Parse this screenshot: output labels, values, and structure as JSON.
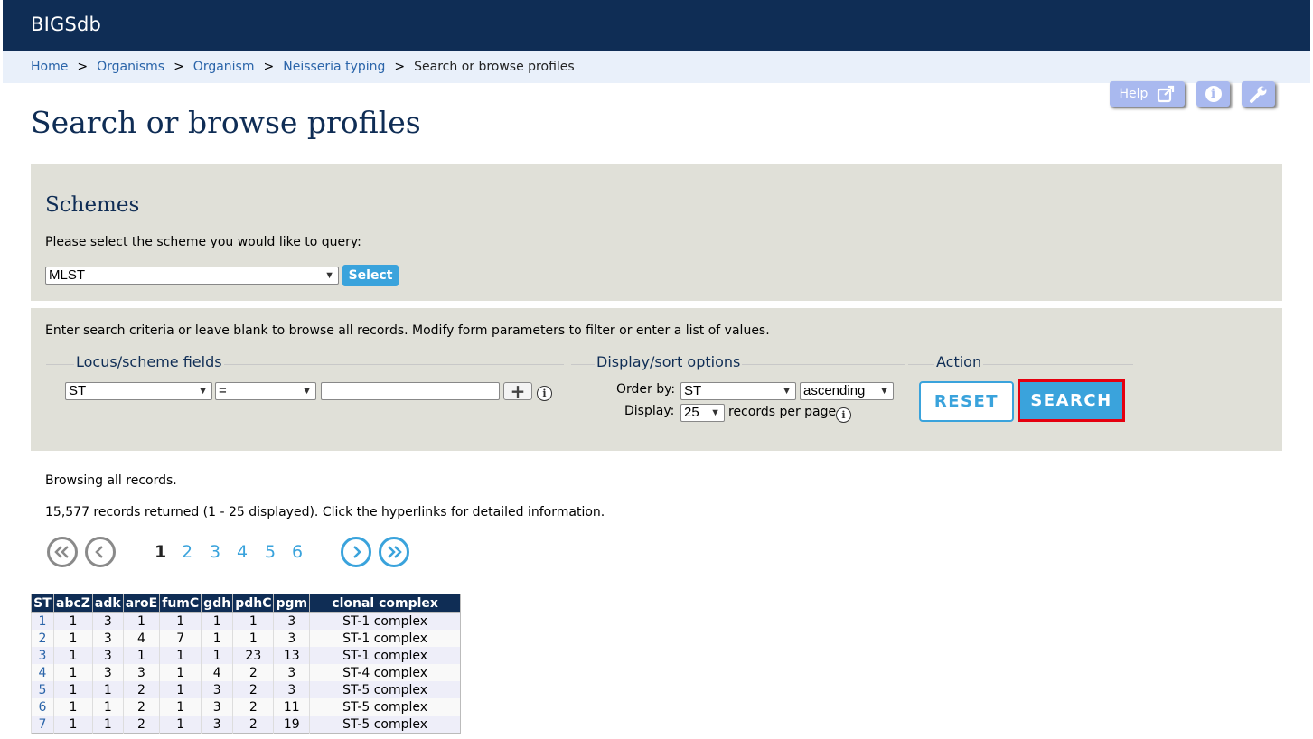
{
  "header": {
    "brand": "BIGSdb"
  },
  "breadcrumb": {
    "items": [
      "Home",
      "Organisms",
      "Organism",
      "Neisseria typing"
    ],
    "separator": ">",
    "current": "Search or browse profiles"
  },
  "toolbar": {
    "help_label": "Help"
  },
  "page_title": "Search or browse profiles",
  "schemes": {
    "heading": "Schemes",
    "prompt": "Please select the scheme you would like to query:",
    "selected_scheme": "MLST",
    "select_button": "Select"
  },
  "search": {
    "intro": "Enter search criteria or leave blank to browse all records. Modify form parameters to filter or enter a list of values.",
    "locus_legend": "Locus/scheme fields",
    "locus_field": "ST",
    "operator": "=",
    "value": "",
    "display_legend": "Display/sort options",
    "order_by_label": "Order by:",
    "order_by": "ST",
    "direction": "ascending",
    "display_label": "Display:",
    "per_page": "25",
    "per_page_suffix": "records per page",
    "action_legend": "Action",
    "reset_label": "RESET",
    "search_label": "SEARCH"
  },
  "results": {
    "status": "Browsing all records.",
    "summary": "15,577 records returned (1 - 25 displayed). Click the hyperlinks for detailed information.",
    "pages": [
      "1",
      "2",
      "3",
      "4",
      "5",
      "6"
    ],
    "current_page": "1",
    "columns": [
      "ST",
      "abcZ",
      "adk",
      "aroE",
      "fumC",
      "gdh",
      "pdhC",
      "pgm",
      "clonal complex"
    ],
    "rows": [
      [
        "1",
        "1",
        "3",
        "1",
        "1",
        "1",
        "1",
        "3",
        "ST-1 complex"
      ],
      [
        "2",
        "1",
        "3",
        "4",
        "7",
        "1",
        "1",
        "3",
        "ST-1 complex"
      ],
      [
        "3",
        "1",
        "3",
        "1",
        "1",
        "1",
        "23",
        "13",
        "ST-1 complex"
      ],
      [
        "4",
        "1",
        "3",
        "3",
        "1",
        "4",
        "2",
        "3",
        "ST-4 complex"
      ],
      [
        "5",
        "1",
        "1",
        "2",
        "1",
        "3",
        "2",
        "3",
        "ST-5 complex"
      ],
      [
        "6",
        "1",
        "1",
        "2",
        "1",
        "3",
        "2",
        "11",
        "ST-5 complex"
      ],
      [
        "7",
        "1",
        "1",
        "2",
        "1",
        "3",
        "2",
        "19",
        "ST-5 complex"
      ]
    ]
  },
  "colors": {
    "header_bg": "#0f2d55",
    "accent": "#3aa3dc",
    "highlight": "#e5000f",
    "panel_bg": "#e0e0d8"
  }
}
